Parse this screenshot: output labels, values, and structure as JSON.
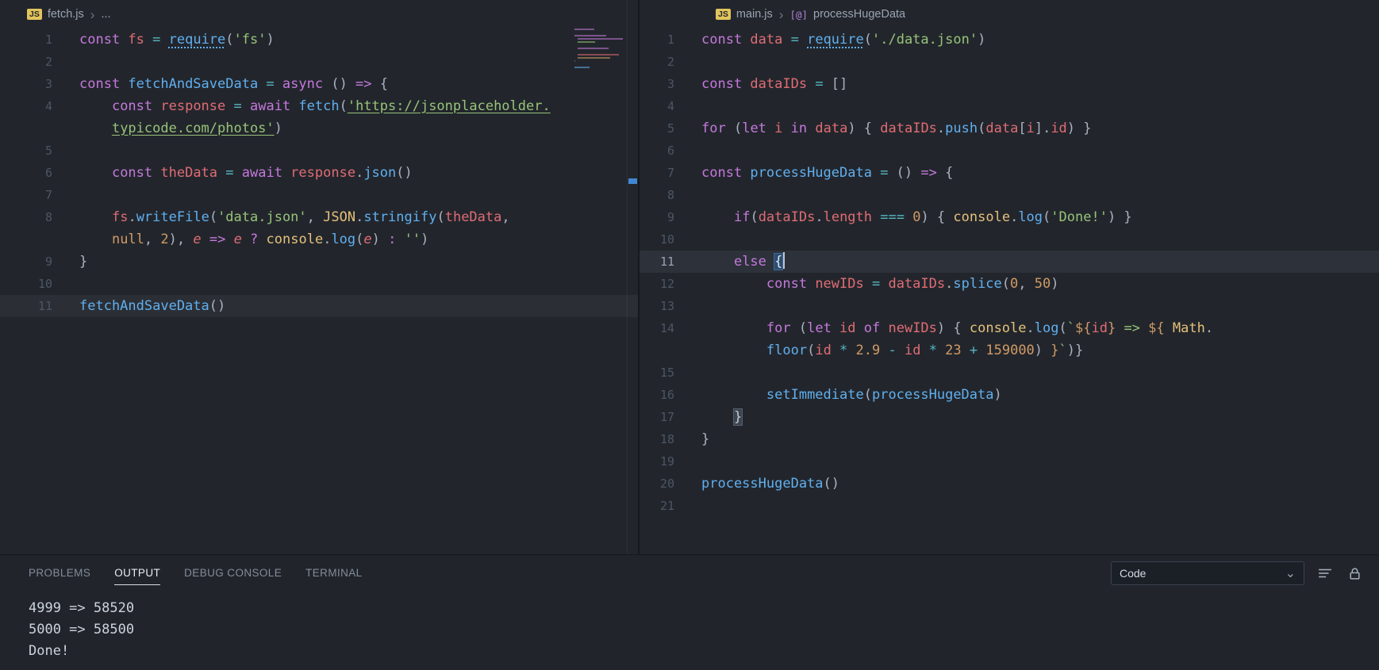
{
  "colors": {
    "syntax": {
      "k": "#c678dd",
      "v": "#e06c75",
      "f": "#61afef",
      "s": "#98c379",
      "n": "#d19a66",
      "c": "#e5c07b",
      "o": "#56b6c2",
      "p": "#abb2bf",
      "tx": "#d19a66"
    },
    "ui": {
      "editor_bg": "#22262c",
      "panel_bg": "#21252b",
      "accent_blue": "#3f87d2",
      "js_badge": "#e2c45c"
    }
  },
  "icons": {
    "js_badge": "JS",
    "breadcrumb_chevron": "›",
    "dropdown_chevron": "⌄",
    "symbol_method": "[@]"
  },
  "breadcrumbs": {
    "left": {
      "file": "fetch.js",
      "trail": "..."
    },
    "right": {
      "file": "main.js",
      "symbol": "processHugeData"
    }
  },
  "editors": {
    "left": {
      "rows": [
        {
          "ln": "1",
          "i": 0,
          "t": [
            [
              "k",
              "const "
            ],
            [
              "v",
              "fs "
            ],
            [
              "o",
              "= "
            ],
            [
              "fd",
              "require"
            ],
            [
              "p",
              "("
            ],
            [
              "s",
              "'fs'"
            ],
            [
              "p",
              ")"
            ]
          ]
        },
        {
          "ln": "2",
          "i": 0,
          "t": []
        },
        {
          "ln": "3",
          "i": 0,
          "t": [
            [
              "k",
              "const "
            ],
            [
              "f",
              "fetchAndSaveData "
            ],
            [
              "o",
              "= "
            ],
            [
              "k",
              "async "
            ],
            [
              "p",
              "() "
            ],
            [
              "k",
              "=> "
            ],
            [
              "p",
              "{"
            ]
          ]
        },
        {
          "ln": "4",
          "i": 4,
          "t": [
            [
              "k",
              "const "
            ],
            [
              "v",
              "response "
            ],
            [
              "o",
              "= "
            ],
            [
              "k",
              "await "
            ],
            [
              "f",
              "fetch"
            ],
            [
              "p",
              "("
            ],
            [
              "su",
              "'https://jsonplaceholder."
            ]
          ]
        },
        {
          "ln": "",
          "i": 4,
          "t": [
            [
              "su",
              "typicode.com/photos'"
            ],
            [
              "p",
              ")"
            ]
          ]
        },
        {
          "ln": "5",
          "i": 0,
          "t": []
        },
        {
          "ln": "6",
          "i": 4,
          "t": [
            [
              "k",
              "const "
            ],
            [
              "v",
              "theData "
            ],
            [
              "o",
              "= "
            ],
            [
              "k",
              "await "
            ],
            [
              "v",
              "response"
            ],
            [
              "p",
              "."
            ],
            [
              "f",
              "json"
            ],
            [
              "p",
              "()"
            ]
          ]
        },
        {
          "ln": "7",
          "i": 0,
          "t": []
        },
        {
          "ln": "8",
          "i": 4,
          "t": [
            [
              "v",
              "fs"
            ],
            [
              "p",
              "."
            ],
            [
              "f",
              "writeFile"
            ],
            [
              "p",
              "("
            ],
            [
              "s",
              "'data.json'"
            ],
            [
              "p",
              ", "
            ],
            [
              "c",
              "JSON"
            ],
            [
              "p",
              "."
            ],
            [
              "f",
              "stringify"
            ],
            [
              "p",
              "("
            ],
            [
              "v",
              "theData"
            ],
            [
              "p",
              ","
            ]
          ]
        },
        {
          "ln": "",
          "i": 4,
          "t": [
            [
              "n",
              "null"
            ],
            [
              "p",
              ", "
            ],
            [
              "n",
              "2"
            ],
            [
              "p",
              "), "
            ],
            [
              "vi",
              "e "
            ],
            [
              "k",
              "=> "
            ],
            [
              "vi",
              "e "
            ],
            [
              "k",
              "? "
            ],
            [
              "c",
              "console"
            ],
            [
              "p",
              "."
            ],
            [
              "f",
              "log"
            ],
            [
              "p",
              "("
            ],
            [
              "vi",
              "e"
            ],
            [
              "p",
              ") "
            ],
            [
              "k",
              ": "
            ],
            [
              "s",
              "''"
            ],
            [
              "p",
              ")"
            ]
          ]
        },
        {
          "ln": "9",
          "i": 0,
          "t": [
            [
              "p",
              "}"
            ]
          ]
        },
        {
          "ln": "10",
          "i": 0,
          "t": []
        },
        {
          "ln": "11",
          "i": 0,
          "cls": "cur-subtle",
          "t": [
            [
              "f",
              "fetchAndSaveData"
            ],
            [
              "p",
              "()"
            ]
          ]
        }
      ]
    },
    "right": {
      "rows": [
        {
          "ln": "1",
          "i": 0,
          "t": [
            [
              "k",
              "const "
            ],
            [
              "v",
              "data "
            ],
            [
              "o",
              "= "
            ],
            [
              "fd",
              "require"
            ],
            [
              "p",
              "("
            ],
            [
              "s",
              "'./data.json'"
            ],
            [
              "p",
              ")"
            ]
          ]
        },
        {
          "ln": "2",
          "i": 0,
          "t": []
        },
        {
          "ln": "3",
          "i": 0,
          "t": [
            [
              "k",
              "const "
            ],
            [
              "v",
              "dataIDs "
            ],
            [
              "o",
              "= "
            ],
            [
              "p",
              "[]"
            ]
          ]
        },
        {
          "ln": "4",
          "i": 0,
          "t": []
        },
        {
          "ln": "5",
          "i": 0,
          "t": [
            [
              "k",
              "for "
            ],
            [
              "p",
              "("
            ],
            [
              "k",
              "let "
            ],
            [
              "v",
              "i "
            ],
            [
              "k",
              "in "
            ],
            [
              "v",
              "data"
            ],
            [
              "p",
              ") { "
            ],
            [
              "v",
              "dataIDs"
            ],
            [
              "p",
              "."
            ],
            [
              "f",
              "push"
            ],
            [
              "p",
              "("
            ],
            [
              "v",
              "data"
            ],
            [
              "p",
              "["
            ],
            [
              "v",
              "i"
            ],
            [
              "p",
              "]."
            ],
            [
              "v",
              "id"
            ],
            [
              "p",
              ") }"
            ]
          ]
        },
        {
          "ln": "6",
          "i": 0,
          "t": []
        },
        {
          "ln": "7",
          "i": 0,
          "t": [
            [
              "k",
              "const "
            ],
            [
              "f",
              "processHugeData "
            ],
            [
              "o",
              "= "
            ],
            [
              "p",
              "() "
            ],
            [
              "k",
              "=> "
            ],
            [
              "p",
              "{"
            ]
          ]
        },
        {
          "ln": "8",
          "i": 0,
          "t": []
        },
        {
          "ln": "9",
          "i": 4,
          "t": [
            [
              "k",
              "if"
            ],
            [
              "p",
              "("
            ],
            [
              "v",
              "dataIDs"
            ],
            [
              "p",
              "."
            ],
            [
              "v",
              "length "
            ],
            [
              "o",
              "=== "
            ],
            [
              "n",
              "0"
            ],
            [
              "p",
              ") { "
            ],
            [
              "c",
              "console"
            ],
            [
              "p",
              "."
            ],
            [
              "f",
              "log"
            ],
            [
              "p",
              "("
            ],
            [
              "s",
              "'Done!'"
            ],
            [
              "p",
              ") }"
            ]
          ]
        },
        {
          "ln": "10",
          "i": 0,
          "t": []
        },
        {
          "ln": "11",
          "i": 4,
          "cls": "active",
          "t": [
            [
              "k",
              "else "
            ],
            [
              "pb2",
              "{"
            ],
            [
              "cursor",
              ""
            ]
          ]
        },
        {
          "ln": "12",
          "i": 8,
          "t": [
            [
              "k",
              "const "
            ],
            [
              "v",
              "newIDs "
            ],
            [
              "o",
              "= "
            ],
            [
              "v",
              "dataIDs"
            ],
            [
              "p",
              "."
            ],
            [
              "f",
              "splice"
            ],
            [
              "p",
              "("
            ],
            [
              "n",
              "0"
            ],
            [
              "p",
              ", "
            ],
            [
              "n",
              "50"
            ],
            [
              "p",
              ")"
            ]
          ]
        },
        {
          "ln": "13",
          "i": 0,
          "t": []
        },
        {
          "ln": "14",
          "i": 8,
          "t": [
            [
              "k",
              "for "
            ],
            [
              "p",
              "("
            ],
            [
              "k",
              "let "
            ],
            [
              "v",
              "id "
            ],
            [
              "k",
              "of "
            ],
            [
              "v",
              "newIDs"
            ],
            [
              "p",
              ") { "
            ],
            [
              "c",
              "console"
            ],
            [
              "p",
              "."
            ],
            [
              "f",
              "log"
            ],
            [
              "p",
              "("
            ],
            [
              "s",
              "`"
            ],
            [
              "tx",
              "${"
            ],
            [
              "v",
              "id"
            ],
            [
              "tx",
              "}"
            ],
            [
              "s",
              " => "
            ],
            [
              "tx",
              "${"
            ],
            [
              "d",
              " "
            ],
            [
              "c",
              "Math"
            ],
            [
              "p",
              "."
            ]
          ]
        },
        {
          "ln": "",
          "i": 8,
          "t": [
            [
              "f",
              "floor"
            ],
            [
              "p",
              "("
            ],
            [
              "v",
              "id "
            ],
            [
              "o",
              "* "
            ],
            [
              "n",
              "2.9 "
            ],
            [
              "o",
              "- "
            ],
            [
              "v",
              "id "
            ],
            [
              "o",
              "* "
            ],
            [
              "n",
              "23 "
            ],
            [
              "o",
              "+ "
            ],
            [
              "n",
              "159000"
            ],
            [
              "p",
              ") "
            ],
            [
              "tx",
              "}"
            ],
            [
              "s",
              "`"
            ],
            [
              "p",
              ")}"
            ]
          ]
        },
        {
          "ln": "15",
          "i": 0,
          "t": []
        },
        {
          "ln": "16",
          "i": 8,
          "t": [
            [
              "f",
              "setImmediate"
            ],
            [
              "p",
              "("
            ],
            [
              "f",
              "processHugeData"
            ],
            [
              "p",
              ")"
            ]
          ]
        },
        {
          "ln": "17",
          "i": 4,
          "t": [
            [
              "pb",
              "}"
            ]
          ]
        },
        {
          "ln": "18",
          "i": 0,
          "t": [
            [
              "p",
              "}"
            ]
          ]
        },
        {
          "ln": "19",
          "i": 0,
          "t": []
        },
        {
          "ln": "20",
          "i": 0,
          "t": [
            [
              "f",
              "processHugeData"
            ],
            [
              "p",
              "()"
            ]
          ]
        },
        {
          "ln": "21",
          "i": 0,
          "t": []
        }
      ]
    }
  },
  "panel": {
    "tabs": [
      {
        "label": "PROBLEMS",
        "active": false
      },
      {
        "label": "OUTPUT",
        "active": true
      },
      {
        "label": "DEBUG CONSOLE",
        "active": false
      },
      {
        "label": "TERMINAL",
        "active": false
      }
    ],
    "channel": "Code",
    "output_lines": [
      "4999 => 58520",
      "5000 => 58500",
      "Done!"
    ]
  }
}
